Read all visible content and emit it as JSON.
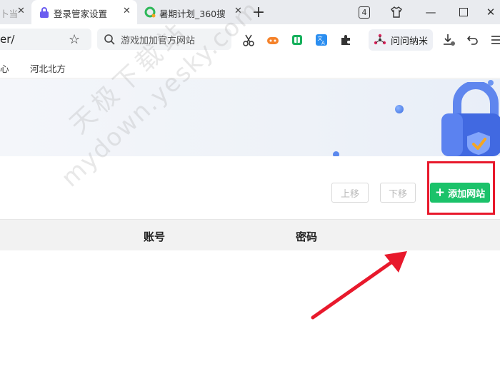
{
  "tabs": [
    {
      "title": "卜当",
      "active": false
    },
    {
      "title": "登录管家设置",
      "active": true
    },
    {
      "title": "暑期计划_360搜",
      "active": false
    }
  ],
  "window": {
    "tab_count": "4"
  },
  "address": {
    "url_fragment": "er/"
  },
  "search": {
    "placeholder": "游戏加加官方网站"
  },
  "assistant": {
    "label": "问问纳米"
  },
  "bookmarks": [
    {
      "label": "心"
    },
    {
      "label": "河北北方"
    }
  ],
  "actions": {
    "move_up": "上移",
    "move_down": "下移",
    "add_site": "添加网站"
  },
  "table": {
    "columns": [
      "账号",
      "密码"
    ]
  },
  "watermark": {
    "line1": "天极下载站",
    "line2": "mydown.yesky.com"
  },
  "colors": {
    "primary": "#1bc26a",
    "highlight": "#e8192c",
    "arrow": "#e8192c"
  }
}
